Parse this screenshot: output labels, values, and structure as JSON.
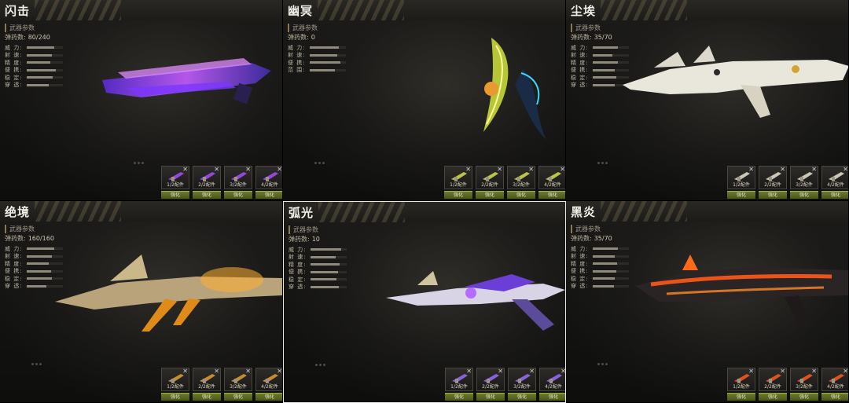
{
  "panels": [
    {
      "title": "闪击",
      "subtitle": "武器参数",
      "ammo_label": "弹药数:",
      "ammo_value": "80/240",
      "stats": [
        {
          "label": "威 力:",
          "level": 0.75
        },
        {
          "label": "射 速:",
          "level": 0.7
        },
        {
          "label": "精 度:",
          "level": 0.65
        },
        {
          "label": "便 携:",
          "level": 0.8
        },
        {
          "label": "稳 定:",
          "level": 0.72
        },
        {
          "label": "穿 透:",
          "level": 0.6
        }
      ],
      "slots": [
        {
          "label": "1/2配件",
          "button": "强化"
        },
        {
          "label": "2/2配件",
          "button": "强化"
        },
        {
          "label": "3/2配件",
          "button": "强化"
        },
        {
          "label": "4/2配件",
          "button": "强化"
        }
      ],
      "accent": "#a84cff"
    },
    {
      "title": "幽冥",
      "subtitle": "武器参数",
      "ammo_label": "弹药数:",
      "ammo_value": "0",
      "stats": [
        {
          "label": "威 力:",
          "level": 0.8
        },
        {
          "label": "射 速:",
          "level": 0.75
        },
        {
          "label": "便 携:",
          "level": 0.85
        },
        {
          "label": "范 围:",
          "level": 0.7
        }
      ],
      "slots": [
        {
          "label": "1/2配件",
          "button": "强化"
        },
        {
          "label": "2/2配件",
          "button": "强化"
        },
        {
          "label": "3/2配件",
          "button": "强化"
        },
        {
          "label": "4/2配件",
          "button": "强化"
        }
      ],
      "accent": "#d6e04a"
    },
    {
      "title": "尘埃",
      "subtitle": "武器参数",
      "ammo_label": "弹药数:",
      "ammo_value": "35/70",
      "stats": [
        {
          "label": "威 力:",
          "level": 0.7
        },
        {
          "label": "射 速:",
          "level": 0.55
        },
        {
          "label": "精 度:",
          "level": 0.7
        },
        {
          "label": "便 携:",
          "level": 0.6
        },
        {
          "label": "稳 定:",
          "level": 0.65
        },
        {
          "label": "穿 透:",
          "level": 0.6
        }
      ],
      "slots": [
        {
          "label": "1/2配件",
          "button": "强化"
        },
        {
          "label": "2/2配件",
          "button": "强化"
        },
        {
          "label": "3/2配件",
          "button": "强化"
        },
        {
          "label": "4/2配件",
          "button": "强化"
        }
      ],
      "accent": "#e8e2d0"
    },
    {
      "title": "绝境",
      "subtitle": "武器参数",
      "ammo_label": "弹药数:",
      "ammo_value": "160/160",
      "stats": [
        {
          "label": "威 力:",
          "level": 0.75
        },
        {
          "label": "射 速:",
          "level": 0.7
        },
        {
          "label": "精 度:",
          "level": 0.6
        },
        {
          "label": "便 携:",
          "level": 0.68
        },
        {
          "label": "稳 定:",
          "level": 0.7
        },
        {
          "label": "穿 透:",
          "level": 0.55
        }
      ],
      "slots": [
        {
          "label": "1/2配件",
          "button": "强化"
        },
        {
          "label": "2/2配件",
          "button": "强化"
        },
        {
          "label": "3/2配件",
          "button": "强化"
        },
        {
          "label": "4/2配件",
          "button": "强化"
        }
      ],
      "accent": "#e0a030"
    },
    {
      "title": "弧光",
      "subtitle": "武器参数",
      "ammo_label": "弹药数:",
      "ammo_value": "10",
      "stats": [
        {
          "label": "威 力:",
          "level": 0.85
        },
        {
          "label": "射 速:",
          "level": 0.7
        },
        {
          "label": "精 度:",
          "level": 0.8
        },
        {
          "label": "便 携:",
          "level": 0.75
        },
        {
          "label": "稳 定:",
          "level": 0.72
        },
        {
          "label": "穿 透:",
          "level": 0.78
        }
      ],
      "slots": [
        {
          "label": "1/2配件",
          "button": "强化"
        },
        {
          "label": "2/2配件",
          "button": "强化"
        },
        {
          "label": "3/2配件",
          "button": "强化"
        },
        {
          "label": "4/2配件",
          "button": "强化"
        }
      ],
      "accent": "#9c6cff"
    },
    {
      "title": "黑炎",
      "subtitle": "武器参数",
      "ammo_label": "弹药数:",
      "ammo_value": "35/70",
      "stats": [
        {
          "label": "威 力:",
          "level": 0.7
        },
        {
          "label": "射 速:",
          "level": 0.6
        },
        {
          "label": "精 度:",
          "level": 0.68
        },
        {
          "label": "便 携:",
          "level": 0.65
        },
        {
          "label": "稳 定:",
          "level": 0.6
        },
        {
          "label": "穿 透:",
          "level": 0.58
        }
      ],
      "slots": [
        {
          "label": "1/2配件",
          "button": "强化"
        },
        {
          "label": "2/2配件",
          "button": "强化"
        },
        {
          "label": "3/2配件",
          "button": "强化"
        },
        {
          "label": "4/2配件",
          "button": "强化"
        }
      ],
      "accent": "#ff5a1a"
    }
  ]
}
